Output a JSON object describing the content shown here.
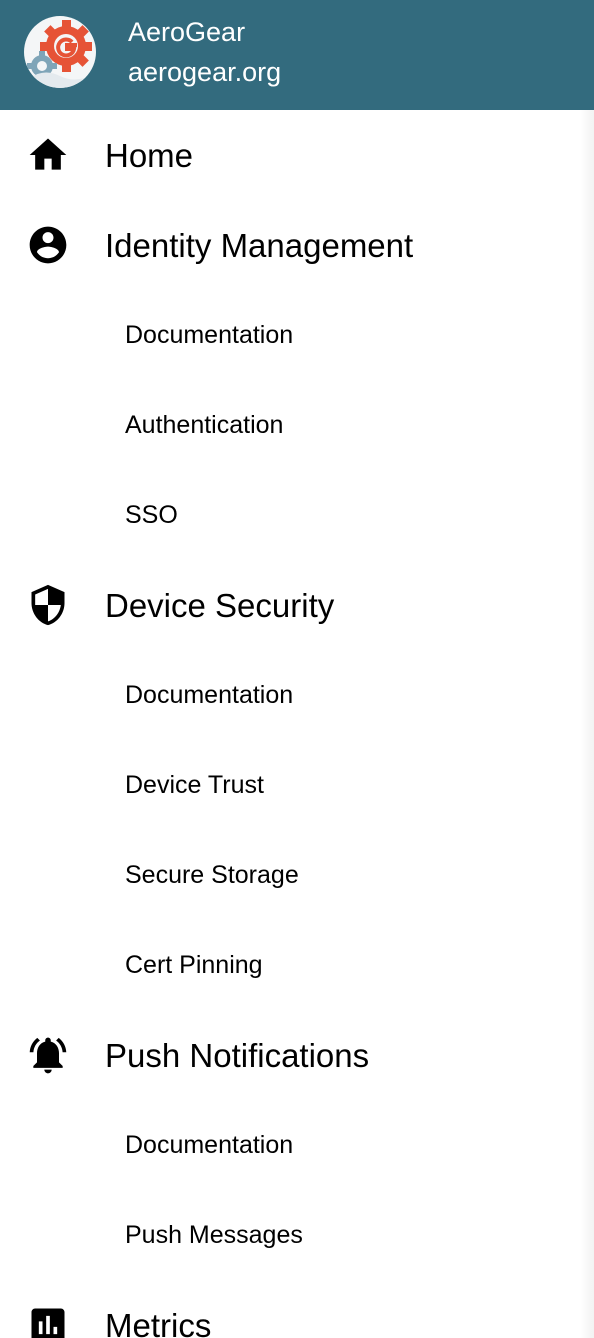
{
  "header": {
    "app_name": "AeroGear",
    "app_domain": "aerogear.org",
    "background_color": "#336b7e",
    "logo_icon": "aerogear-gear-logo-icon"
  },
  "nav": {
    "home": {
      "label": "Home",
      "icon": "home-icon"
    },
    "identity": {
      "label": "Identity Management",
      "icon": "account-circle-icon",
      "items": [
        "Documentation",
        "Authentication",
        "SSO"
      ]
    },
    "device_security": {
      "label": "Device Security",
      "icon": "shield-icon",
      "items": [
        "Documentation",
        "Device Trust",
        "Secure Storage",
        "Cert Pinning"
      ]
    },
    "push": {
      "label": "Push Notifications",
      "icon": "notification-bell-icon",
      "items": [
        "Documentation",
        "Push Messages"
      ]
    },
    "metrics": {
      "label": "Metrics",
      "icon": "bar-chart-icon"
    }
  }
}
